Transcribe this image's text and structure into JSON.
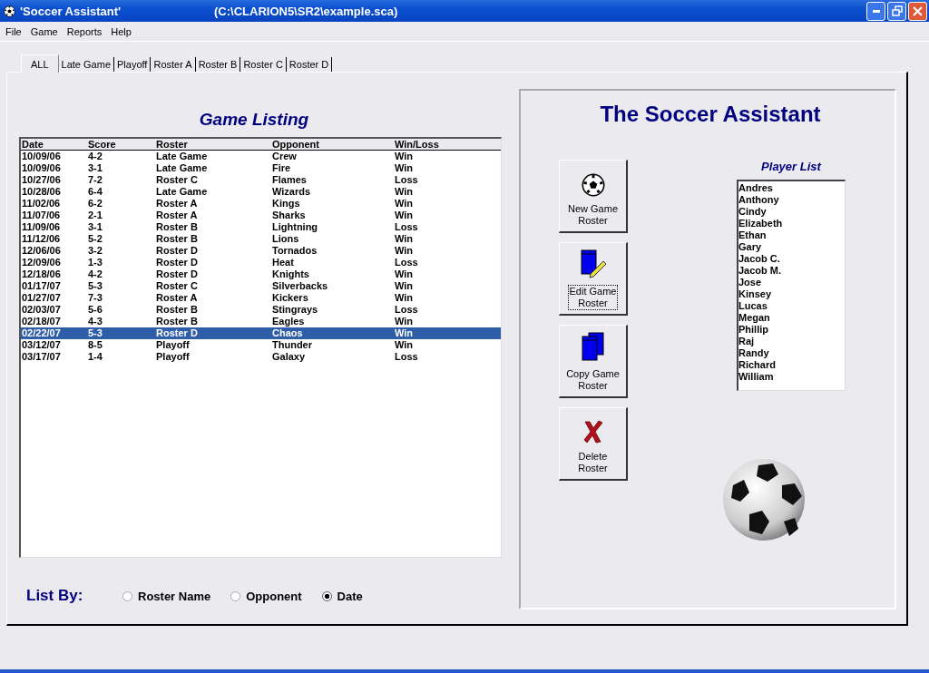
{
  "window": {
    "title": "'Soccer Assistant'",
    "path": "(C:\\CLARION5\\SR2\\example.sca)"
  },
  "menu": [
    "File",
    "Game",
    "Reports",
    "Help"
  ],
  "tabs": [
    {
      "label": "ALL",
      "selected": true
    },
    {
      "label": "Late Game",
      "selected": false
    },
    {
      "label": "Playoff",
      "selected": false
    },
    {
      "label": "Roster A",
      "selected": false
    },
    {
      "label": "Roster B",
      "selected": false
    },
    {
      "label": "Roster C",
      "selected": false
    },
    {
      "label": "Roster D",
      "selected": false
    }
  ],
  "game_listing": {
    "title": "Game Listing",
    "columns": [
      "Date",
      "Score",
      "Roster",
      "Opponent",
      "Win/Loss"
    ],
    "rows": [
      {
        "cells": [
          "10/09/06",
          "4-2",
          "Late Game",
          "Crew",
          "Win"
        ],
        "selected": false
      },
      {
        "cells": [
          "10/09/06",
          "3-1",
          "Late Game",
          "Fire",
          "Win"
        ],
        "selected": false
      },
      {
        "cells": [
          "10/27/06",
          "7-2",
          "Roster C",
          "Flames",
          "Loss"
        ],
        "selected": false
      },
      {
        "cells": [
          "10/28/06",
          "6-4",
          "Late Game",
          "Wizards",
          "Win"
        ],
        "selected": false
      },
      {
        "cells": [
          "11/02/06",
          "6-2",
          "Roster A",
          "Kings",
          "Win"
        ],
        "selected": false
      },
      {
        "cells": [
          "11/07/06",
          "2-1",
          "Roster A",
          "Sharks",
          "Win"
        ],
        "selected": false
      },
      {
        "cells": [
          "11/09/06",
          "3-1",
          "Roster B",
          "Lightning",
          "Loss"
        ],
        "selected": false
      },
      {
        "cells": [
          "11/12/06",
          "5-2",
          "Roster B",
          "Lions",
          "Win"
        ],
        "selected": false
      },
      {
        "cells": [
          "12/06/06",
          "3-2",
          "Roster D",
          "Tornados",
          "Win"
        ],
        "selected": false
      },
      {
        "cells": [
          "12/09/06",
          "1-3",
          "Roster D",
          "Heat",
          "Loss"
        ],
        "selected": false
      },
      {
        "cells": [
          "12/18/06",
          "4-2",
          "Roster D",
          "Knights",
          "Win"
        ],
        "selected": false
      },
      {
        "cells": [
          "01/17/07",
          "5-3",
          "Roster C",
          "Silverbacks",
          "Win"
        ],
        "selected": false
      },
      {
        "cells": [
          "01/27/07",
          "7-3",
          "Roster A",
          "Kickers",
          "Win"
        ],
        "selected": false
      },
      {
        "cells": [
          "02/03/07",
          "5-6",
          "Roster B",
          "Stingrays",
          "Loss"
        ],
        "selected": false
      },
      {
        "cells": [
          "02/18/07",
          "4-3",
          "Roster B",
          "Eagles",
          "Win"
        ],
        "selected": false
      },
      {
        "cells": [
          "02/22/07",
          "5-3",
          "Roster D",
          "Chaos",
          "Win"
        ],
        "selected": true
      },
      {
        "cells": [
          "03/12/07",
          "8-5",
          "Playoff",
          "Thunder",
          "Win"
        ],
        "selected": false
      },
      {
        "cells": [
          "03/17/07",
          "1-4",
          "Playoff",
          "Galaxy",
          "Loss"
        ],
        "selected": false
      }
    ]
  },
  "list_by": {
    "label": "List By:",
    "options": [
      {
        "label": "Roster Name",
        "selected": false
      },
      {
        "label": "Opponent",
        "selected": false
      },
      {
        "label": "Date",
        "selected": true
      }
    ]
  },
  "assistant": {
    "title": "The Soccer Assistant",
    "buttons": [
      {
        "kind": "new",
        "lines": [
          "New Game",
          "Roster"
        ],
        "focused": false
      },
      {
        "kind": "edit",
        "lines": [
          "Edit Game",
          "Roster"
        ],
        "focused": true
      },
      {
        "kind": "copy",
        "lines": [
          "Copy Game",
          "Roster"
        ],
        "focused": false
      },
      {
        "kind": "delete",
        "lines": [
          "Delete",
          "Roster"
        ],
        "focused": false
      }
    ],
    "player_list": {
      "title": "Player List",
      "players": [
        "Andres",
        "Anthony",
        "Cindy",
        "Elizabeth",
        "Ethan",
        "Gary",
        "Jacob C.",
        "Jacob M.",
        "Jose",
        "Kinsey",
        "Lucas",
        "Megan",
        "Phillip",
        "Raj",
        "Randy",
        "Richard",
        "William"
      ]
    }
  }
}
